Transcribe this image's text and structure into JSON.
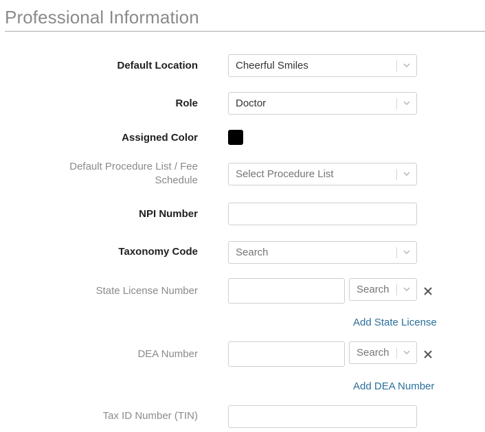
{
  "section": {
    "title": "Professional Information"
  },
  "fields": {
    "default_location": {
      "label": "Default Location",
      "value": "Cheerful Smiles"
    },
    "role": {
      "label": "Role",
      "value": "Doctor"
    },
    "assigned_color": {
      "label": "Assigned Color",
      "color": "#000000"
    },
    "procedure_list": {
      "label_line1": "Default Procedure List / Fee",
      "label_line2": "Schedule",
      "placeholder": "Select Procedure List"
    },
    "npi_number": {
      "label": "NPI Number",
      "value": ""
    },
    "taxonomy_code": {
      "label": "Taxonomy Code",
      "placeholder": "Search"
    },
    "state_license": {
      "label": "State License Number",
      "value": "",
      "state_placeholder": "Search",
      "add_link": "Add State License"
    },
    "dea_number": {
      "label": "DEA Number",
      "value": "",
      "state_placeholder": "Search",
      "add_link": "Add DEA Number"
    },
    "tax_id": {
      "label": "Tax ID Number (TIN)",
      "value": ""
    }
  },
  "icons": {
    "dropdown": "chevron-down-icon",
    "remove": "close-icon"
  },
  "colors": {
    "link": "#2a6f9b",
    "required_label": "#1f1f1f",
    "optional_label": "#8a8a8a"
  }
}
